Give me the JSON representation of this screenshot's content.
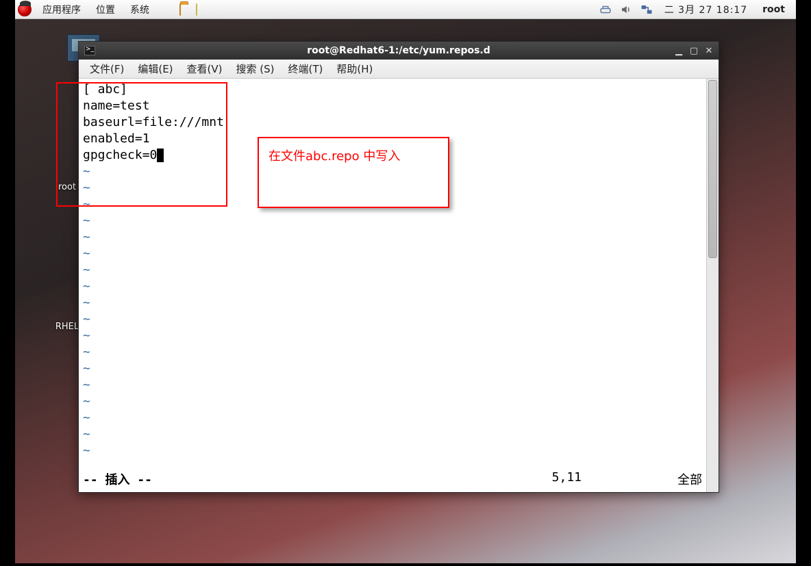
{
  "panel": {
    "menus": {
      "apps": "应用程序",
      "places": "位置",
      "system": "系统"
    },
    "clock": "二 3月 27 18:17",
    "user": "root"
  },
  "desktop_icons": {
    "home": "root",
    "rhel": "RHEL"
  },
  "window": {
    "title": "root@Redhat6-1:/etc/yum.repos.d",
    "menus": {
      "file": "文件(F)",
      "edit": "编辑(E)",
      "view": "查看(V)",
      "search": "搜索 (S)",
      "terminal": "终端(T)",
      "help": "帮助(H)"
    },
    "editor": {
      "lines": [
        "[ abc]",
        "name=test",
        "baseurl=file:///mnt",
        "enabled=1",
        "gpgcheck=0"
      ],
      "mode": "-- 插入 --",
      "position": "5,11",
      "percent": "全部"
    }
  },
  "annotation": "在文件abc.repo 中写入"
}
